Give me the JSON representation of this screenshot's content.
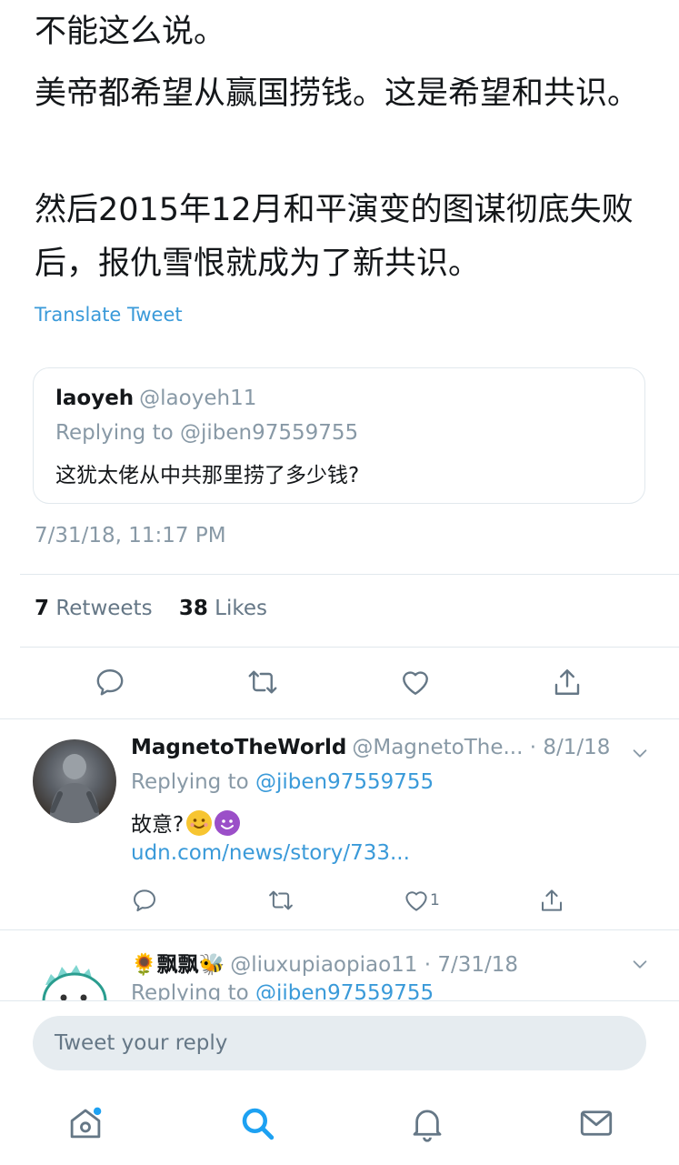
{
  "tweet": {
    "paragraphs": [
      "不能这么说。",
      "美帝都希望从赢国捞钱。这是希望和共识。",
      "然后2015年12月和平演变的图谋彻底失败后，报仇雪恨就成为了新共识。"
    ],
    "translate_label": "Translate Tweet",
    "quoted": {
      "name": "laoyeh",
      "handle": "@laoyeh11",
      "replying": "Replying to @jiben97559755",
      "text": "这犹太佬从中共那里捞了多少钱?"
    },
    "timestamp": "7/31/18, 11:17 PM",
    "stats": {
      "retweets_count": "7",
      "retweets_label": "Retweets",
      "likes_count": "38",
      "likes_label": "Likes"
    }
  },
  "icons": {
    "reply": "reply-icon",
    "retweet": "retweet-icon",
    "like": "heart-icon",
    "share": "share-icon",
    "chevron": "chevron-down-icon"
  },
  "replies": [
    {
      "name": "MagnetoTheWorld",
      "handle": "@MagnetoThe... · 8/1/18",
      "replying_prefix": "Replying to",
      "replying_handle": "@jiben97559755",
      "text": "故意?",
      "emojis": [
        "smiling-face",
        "smiling-devil"
      ],
      "link": "udn.com/news/story/733...",
      "likes": "1"
    },
    {
      "name": "🌻飘飘🐝",
      "handle": "@liuxupiaopiao11 · 7/31/18",
      "replying_prefix": "Replying to",
      "replying_handle": "@jiben97559755"
    }
  ],
  "compose": {
    "placeholder": "Tweet your reply"
  },
  "tabbar": {
    "items": [
      "home-icon",
      "search-icon",
      "notifications-icon",
      "messages-icon"
    ],
    "active": "search",
    "accent": "#1da1f2",
    "icon_color": "#657786"
  }
}
